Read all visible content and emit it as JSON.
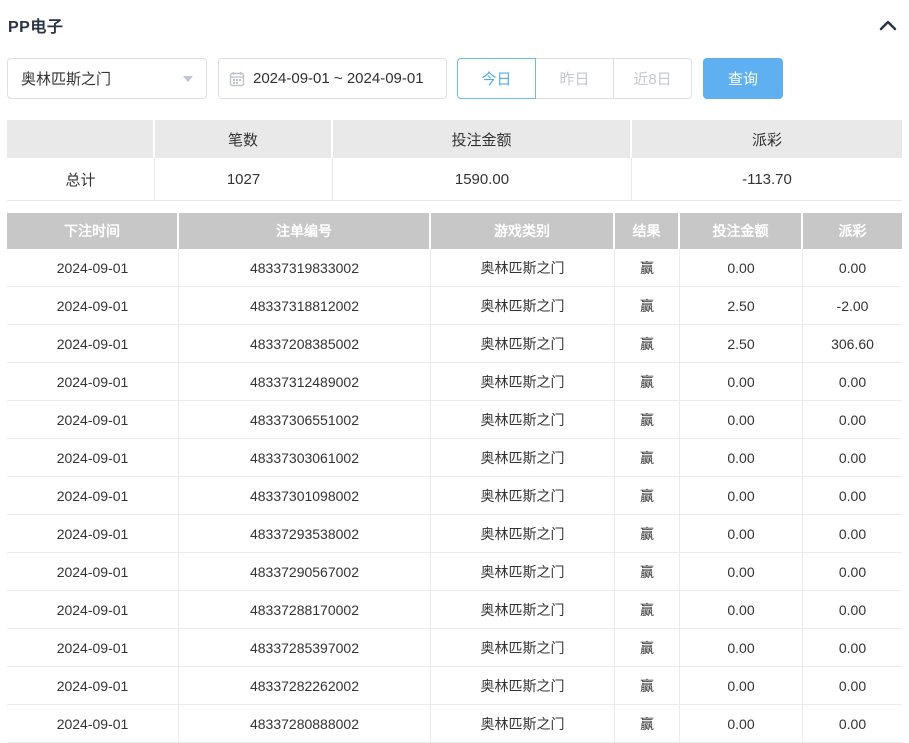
{
  "header": {
    "title": "PP电子"
  },
  "filters": {
    "game_select": {
      "value": "奥林匹斯之门"
    },
    "date_range": {
      "value": "2024-09-01 ~ 2024-09-01"
    },
    "quick_buttons": {
      "today": "今日",
      "yesterday": "昨日",
      "last8days": "近8日"
    },
    "query_label": "查询"
  },
  "summary": {
    "columns": [
      "",
      "笔数",
      "投注金额",
      "派彩"
    ],
    "row": {
      "label": "总计",
      "count": "1027",
      "bet_amount": "1590.00",
      "payout": "-113.70"
    }
  },
  "table": {
    "columns": [
      "下注时间",
      "注单编号",
      "游戏类别",
      "结果",
      "投注金额",
      "派彩"
    ],
    "rows": [
      [
        "2024-09-01",
        "48337319833002",
        "奥林匹斯之门",
        "赢",
        "0.00",
        "0.00"
      ],
      [
        "2024-09-01",
        "48337318812002",
        "奥林匹斯之门",
        "赢",
        "2.50",
        "-2.00"
      ],
      [
        "2024-09-01",
        "48337208385002",
        "奥林匹斯之门",
        "赢",
        "2.50",
        "306.60"
      ],
      [
        "2024-09-01",
        "48337312489002",
        "奥林匹斯之门",
        "赢",
        "0.00",
        "0.00"
      ],
      [
        "2024-09-01",
        "48337306551002",
        "奥林匹斯之门",
        "赢",
        "0.00",
        "0.00"
      ],
      [
        "2024-09-01",
        "48337303061002",
        "奥林匹斯之门",
        "赢",
        "0.00",
        "0.00"
      ],
      [
        "2024-09-01",
        "48337301098002",
        "奥林匹斯之门",
        "赢",
        "0.00",
        "0.00"
      ],
      [
        "2024-09-01",
        "48337293538002",
        "奥林匹斯之门",
        "赢",
        "0.00",
        "0.00"
      ],
      [
        "2024-09-01",
        "48337290567002",
        "奥林匹斯之门",
        "赢",
        "0.00",
        "0.00"
      ],
      [
        "2024-09-01",
        "48337288170002",
        "奥林匹斯之门",
        "赢",
        "0.00",
        "0.00"
      ],
      [
        "2024-09-01",
        "48337285397002",
        "奥林匹斯之门",
        "赢",
        "0.00",
        "0.00"
      ],
      [
        "2024-09-01",
        "48337282262002",
        "奥林匹斯之门",
        "赢",
        "0.00",
        "0.00"
      ],
      [
        "2024-09-01",
        "48337280888002",
        "奥林匹斯之门",
        "赢",
        "0.00",
        "0.00"
      ]
    ]
  },
  "colors": {
    "accent_blue": "#5fb0f0",
    "active_tab_blue": "#55abef",
    "negative_red": "#f56c6c",
    "table_header_gray": "#c7c7c7",
    "summary_header_gray": "#e9e9e9"
  }
}
